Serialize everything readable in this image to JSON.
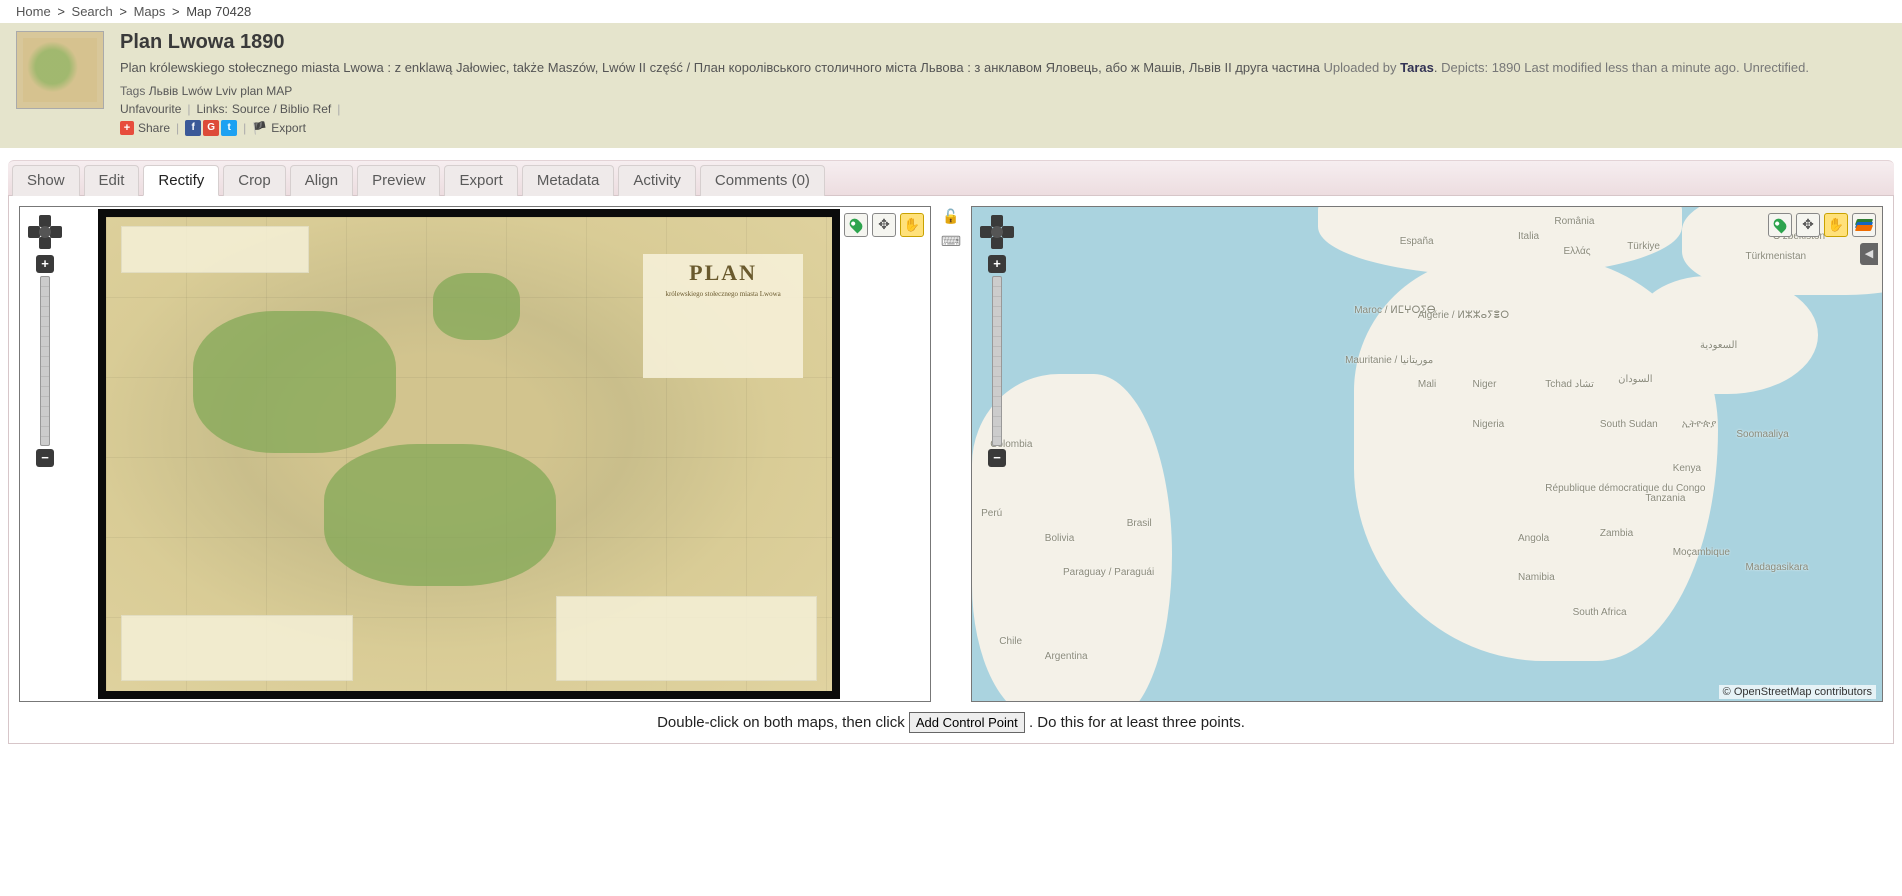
{
  "breadcrumb": {
    "home": "Home",
    "search": "Search",
    "maps": "Maps",
    "current": "Map 70428"
  },
  "header": {
    "title": "Plan Lwowa 1890",
    "description": "Plan królewskiego stołecznego miasta Lwowa : z enklawą Jałowiec, także Maszów, Lwów II część / План королівського столичного міста Львова : з анклавом Яловець, або ж Машів, Львів ІІ друга частина",
    "uploaded_prefix": "Uploaded by",
    "uploader": "Taras",
    "depicts": "Depicts: 1890",
    "last_modified": "Last modified less than a minute ago.",
    "status": "Unrectified.",
    "tags_label": "Tags",
    "tags": "Львів Lwów Lviv plan MAP",
    "unfavourite": "Unfavourite",
    "links_label": "Links:",
    "source_link": "Source / Biblio Ref",
    "share_label": "Share",
    "export_label": "Export"
  },
  "tabs": {
    "show": "Show",
    "edit": "Edit",
    "rectify": "Rectify",
    "crop": "Crop",
    "align": "Align",
    "preview": "Preview",
    "export": "Export",
    "metadata": "Metadata",
    "activity": "Activity",
    "comments": "Comments (0)"
  },
  "maps": {
    "left": {
      "paper_title": "PLAN",
      "paper_sub": "królewskiego stołecznego miasta Lwowa"
    },
    "right": {
      "attribution": "© OpenStreetMap contributors",
      "labels": {
        "espana": "España",
        "italia": "Italia",
        "ellada": "Ελλάς",
        "turkiye": "Türkiye",
        "romania": "România",
        "ozbekiston": "Oʻzbekiston",
        "turkmenistan": "Türkmenistan",
        "maroc": "Maroc / ⵍⵎⵖⵔⵉⴱ",
        "algerie": "Algérie / ⵍⵣⵣⴰⵢⴻⵔ",
        "mauritanie": "Mauritanie / موريتانيا",
        "mali": "Mali",
        "niger": "Niger",
        "tchad": "Tchad تشاد",
        "sudan": "السودان",
        "nigeria": "Nigeria",
        "southsudan": "South Sudan",
        "ethiopia": "ኢትዮጵያ",
        "saudi": "السعودية",
        "soomaaliya": "Soomaaliya",
        "kenya": "Kenya",
        "drc": "République démocratique du Congo",
        "tanzania": "Tanzania",
        "angola": "Angola",
        "zambia": "Zambia",
        "mocambique": "Moçambique",
        "namibia": "Namibia",
        "southafrica": "South Africa",
        "madagasikara": "Madagasikara",
        "colombia": "Colombia",
        "peru": "Perú",
        "bolivia": "Bolivia",
        "brasil": "Brasil",
        "paraguay": "Paraguay / Paraguái",
        "chile": "Chile",
        "argentina": "Argentina"
      }
    }
  },
  "instruction": {
    "pre": "Double-click on both maps, then click ",
    "button": "Add Control Point",
    "post": ". Do this for at least three points."
  }
}
